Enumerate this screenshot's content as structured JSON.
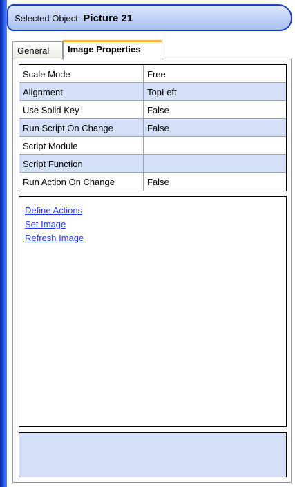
{
  "header": {
    "prefix": "Selected Object:",
    "object_name": "Picture 21"
  },
  "tabs": [
    {
      "label": "General",
      "active": false
    },
    {
      "label": "Image Properties",
      "active": true
    }
  ],
  "properties": [
    {
      "name": "Scale Mode",
      "value": "Free"
    },
    {
      "name": "Alignment",
      "value": "TopLeft"
    },
    {
      "name": "Use Solid Key",
      "value": "False"
    },
    {
      "name": "Run Script On Change",
      "value": "False"
    },
    {
      "name": "Script Module",
      "value": ""
    },
    {
      "name": "Script Function",
      "value": ""
    },
    {
      "name": "Run Action On Change",
      "value": "False"
    }
  ],
  "actions": [
    {
      "label": "Define Actions"
    },
    {
      "label": "Set Image"
    },
    {
      "label": "Refresh Image"
    }
  ],
  "colors": {
    "accent": "#1840c4",
    "row_alt": "#d4e0f8",
    "link": "#1a3ee8",
    "active_tab_highlight": "#f7b640"
  }
}
